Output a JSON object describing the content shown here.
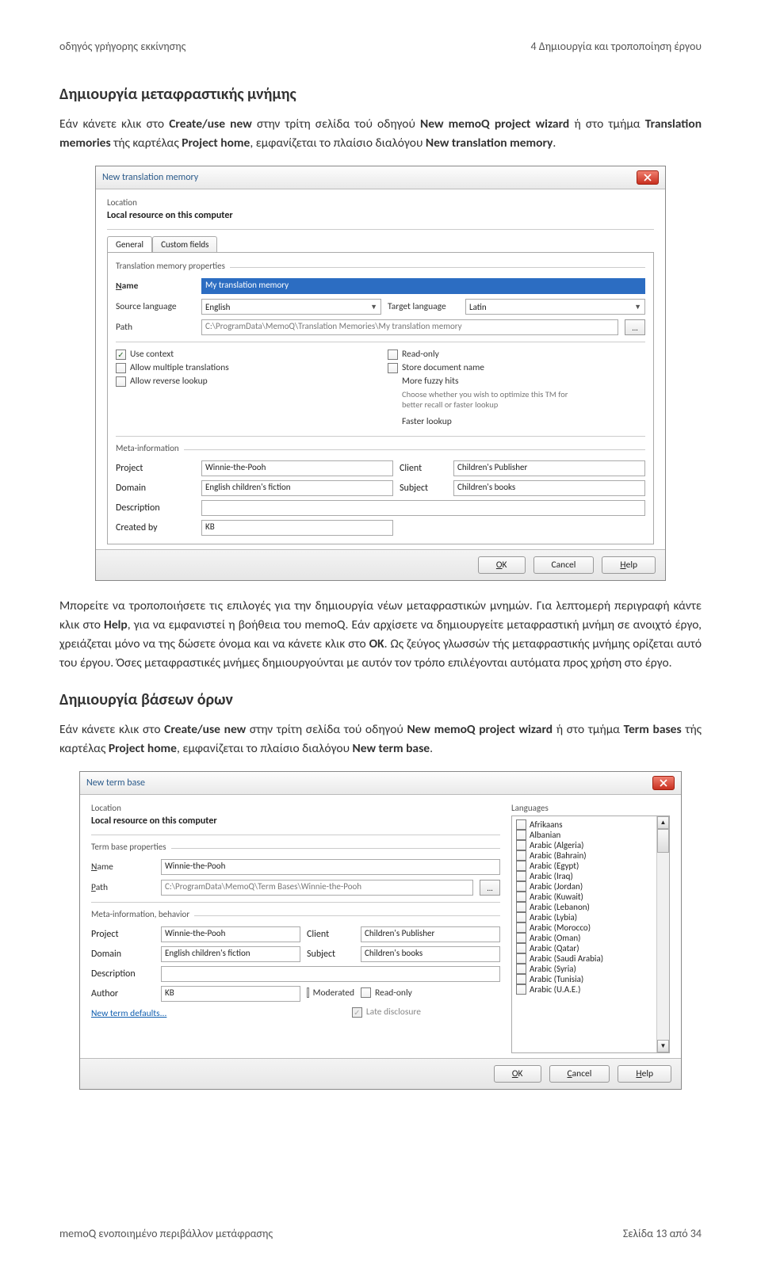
{
  "header": {
    "left": "οδηγός γρήγορης εκκίνησης",
    "right": "4 Δημιουργία και τροποποίηση έργου"
  },
  "h2a": "Δημιουργία μεταφραστικής μνήμης",
  "p1a": "Εάν κάνετε κλικ στο ",
  "p1b": "Create/use new",
  "p1c": " στην τρίτη σελίδα τού οδηγού ",
  "p1d": "New memoQ project wizard",
  "p1e": " ή στο τμήμα ",
  "p1f": "Translation memories",
  "p1g": " τής καρτέλας ",
  "p1h": "Project home",
  "p1i": ", εμφανίζεται το πλαίσιο διαλόγου ",
  "p1j": "New translation memory",
  "p1k": ".",
  "d1": {
    "title": "New translation memory",
    "location": "Location",
    "local": "Local resource on this computer",
    "tab_general": "General",
    "tab_custom": "Custom fields",
    "tm_props": "Translation memory properties",
    "name_lbl": "Name",
    "name_val": "My translation memory",
    "src_lbl": "Source language",
    "src_val": "English",
    "tgt_lbl": "Target language",
    "tgt_val": "Latin",
    "path_lbl": "Path",
    "path_val": "C:\\ProgramData\\MemoQ\\Translation Memories\\My translation memory",
    "use_context": "Use context",
    "allow_mult": "Allow multiple translations",
    "allow_rev": "Allow reverse lookup",
    "read_only": "Read-only",
    "store_doc": "Store document name",
    "more_fuzzy": "More fuzzy hits",
    "tip": "Choose whether you wish to optimize this TM for better recall or faster lookup",
    "faster": "Faster lookup",
    "meta_label": "Meta-information",
    "project_lbl": "Project",
    "project_val": "Winnie-the-Pooh",
    "client_lbl": "Client",
    "client_val": "Children's Publisher",
    "domain_lbl": "Domain",
    "domain_val": "English children's fiction",
    "subject_lbl": "Subject",
    "subject_val": "Children's books",
    "desc_lbl": "Description",
    "created_lbl": "Created by",
    "created_val": "KB",
    "ok": "OK",
    "cancel": "Cancel",
    "help": "Help"
  },
  "p2a": "Μπορείτε να τροποποιήσετε τις επιλογές για την δημιουργία νέων μεταφραστικών μνημών. Για λεπτομερή περιγραφή κάντε κλικ στο ",
  "p2b": "Help",
  "p2c": ", για να εμφανιστεί η βοήθεια του memoQ. Εάν αρχίσετε να δημιουργείτε μεταφραστική μνήμη σε ανοιχτό έργο, χρειάζεται μόνο να της δώσετε όνομα και να κάνετε κλικ στο ",
  "p2d": "OK",
  "p2e": ". Ως ζεύγος γλωσσών τής μεταφραστικής μνήμης ορίζεται αυτό του έργου. Όσες μεταφραστικές μνήμες δημιουργούνται με αυτόν τον τρόπο επιλέγονται αυτόματα προς χρήση στο έργο.",
  "h2b": "Δημιουργία βάσεων όρων",
  "p3a": "Εάν κάνετε κλικ στο ",
  "p3b": "Create/use new",
  "p3c": " στην τρίτη σελίδα τού οδηγού ",
  "p3d": "New memoQ project wizard",
  "p3e": " ή στο τμήμα ",
  "p3f": "Term bases",
  "p3g": " τής καρτέλας ",
  "p3h": "Project home",
  "p3i": ", εμφανίζεται το πλαίσιο διαλόγου ",
  "p3j": "New term base",
  "p3k": ".",
  "d2": {
    "title": "New term base",
    "location": "Location",
    "local": "Local resource on this computer",
    "langs_label": "Languages",
    "tb_props": "Term base properties",
    "name_lbl": "Name",
    "name_val": "Winnie-the-Pooh",
    "path_lbl": "Path",
    "path_val": "C:\\ProgramData\\MemoQ\\Term Bases\\Winnie-the-Pooh",
    "meta_label": "Meta-information, behavior",
    "project_lbl": "Project",
    "project_val": "Winnie-the-Pooh",
    "client_lbl": "Client",
    "client_val": "Children's Publisher",
    "domain_lbl": "Domain",
    "domain_val": "English children's fiction",
    "subject_lbl": "Subject",
    "subject_val": "Children's books",
    "desc_lbl": "Description",
    "author_lbl": "Author",
    "author_val": "KB",
    "moderated": "Moderated",
    "read_only": "Read-only",
    "late_disc": "Late disclosure",
    "new_term": "New term defaults...",
    "languages": [
      "Afrikaans",
      "Albanian",
      "Arabic (Algeria)",
      "Arabic (Bahrain)",
      "Arabic (Egypt)",
      "Arabic (Iraq)",
      "Arabic (Jordan)",
      "Arabic (Kuwait)",
      "Arabic (Lebanon)",
      "Arabic (Lybia)",
      "Arabic (Morocco)",
      "Arabic (Oman)",
      "Arabic (Qatar)",
      "Arabic (Saudi Arabia)",
      "Arabic (Syria)",
      "Arabic (Tunisia)",
      "Arabic (U.A.E.)"
    ],
    "ok": "OK",
    "cancel": "Cancel",
    "help": "Help"
  },
  "footer": {
    "left": "memoQ ενοποιημένο περιβάλλον μετάφρασης",
    "right": "Σελίδα 13 από 34"
  }
}
